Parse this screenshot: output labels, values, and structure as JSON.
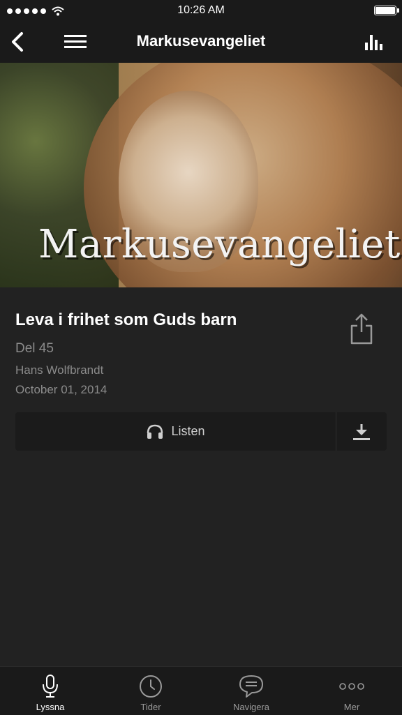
{
  "status_bar": {
    "time": "10:26 AM"
  },
  "nav": {
    "title": "Markusevangeliet"
  },
  "hero": {
    "title": "Markusevangeliet"
  },
  "episode": {
    "title": "Leva i frihet som Guds barn",
    "part": "Del 45",
    "speaker": "Hans Wolfbrandt",
    "date": "October 01, 2014"
  },
  "actions": {
    "listen_label": "Listen"
  },
  "tabs": [
    {
      "label": "Lyssna",
      "icon": "microphone-icon"
    },
    {
      "label": "Tider",
      "icon": "clock-icon"
    },
    {
      "label": "Navigera",
      "icon": "chat-bubble-icon"
    },
    {
      "label": "Mer",
      "icon": "more-dots-icon"
    }
  ],
  "colors": {
    "background": "#222222",
    "bar": "#1a1a1a",
    "muted_text": "#8b8b8b",
    "accent_text": "#ffffff"
  }
}
